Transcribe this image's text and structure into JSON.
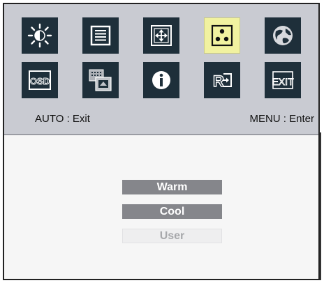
{
  "menu": {
    "icons": [
      {
        "name": "brightness-icon",
        "selected": false
      },
      {
        "name": "picture-settings-icon",
        "selected": false
      },
      {
        "name": "position-icon",
        "selected": false
      },
      {
        "name": "color-temperature-icon",
        "selected": true
      },
      {
        "name": "language-globe-icon",
        "selected": false
      },
      {
        "name": "osd-settings-icon",
        "selected": false,
        "text": "OSD"
      },
      {
        "name": "input-source-icon",
        "selected": false
      },
      {
        "name": "information-icon",
        "selected": false
      },
      {
        "name": "reset-icon",
        "selected": false,
        "text": "R"
      },
      {
        "name": "exit-icon",
        "selected": false,
        "text": "EXIT"
      }
    ],
    "hint_left": "AUTO : Exit",
    "hint_right": "MENU : Enter"
  },
  "options": {
    "warm": "Warm",
    "cool": "Cool",
    "user": "User"
  },
  "colors": {
    "panel_bg": "#c9cbd2",
    "tile_bg": "#1e2f3a",
    "selected_tile": "#f1f2a0",
    "option_bg": "#85868b",
    "option_disabled": "#eeeeef"
  }
}
